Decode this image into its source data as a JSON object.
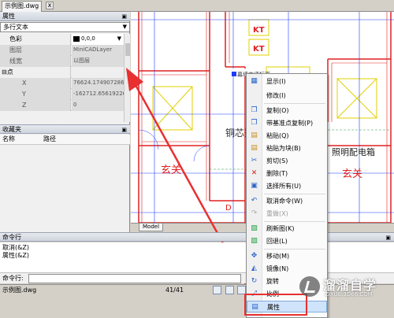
{
  "tab": {
    "title": "示例图.dwg",
    "close": "x"
  },
  "properties": {
    "title": "属性",
    "pin": "ᴘ",
    "object_type": "多行文本",
    "rows": [
      {
        "name": "色彩",
        "value": "0,0,0"
      },
      {
        "name": "图层",
        "value": "MiniCADLayer"
      },
      {
        "name": "线宽",
        "value": "以图层"
      },
      {
        "name": "点",
        "value": ""
      },
      {
        "name": "X",
        "value": "76624.174907286"
      },
      {
        "name": "Y",
        "value": "-162712.65619226"
      },
      {
        "name": "Z",
        "value": "0"
      }
    ],
    "group_toggle": "⊟"
  },
  "favorites": {
    "title": "收藏夹",
    "col_name": "名称",
    "col_path": "路径"
  },
  "drawing": {
    "labels": {
      "kt1": "KT",
      "kt2": "KT",
      "room1": "铜芯梁",
      "room2": "照明配电箱",
      "xuanguan1": "玄关",
      "xuanguan2": "玄关",
      "d_mark": "D",
      "top_text": "幕墙商墙标高"
    },
    "model_tab": "Model"
  },
  "context_menu": {
    "items": [
      {
        "label": "显示(I)",
        "icon": "▦"
      },
      {
        "label": "修改(I)",
        "icon": ""
      },
      {
        "label": "复制(O)",
        "icon": "❐"
      },
      {
        "label": "带基准点复制(P)",
        "icon": "❐"
      },
      {
        "label": "粘贴(Q)",
        "icon": "▤"
      },
      {
        "label": "粘贴为块(B)",
        "icon": "▤"
      },
      {
        "label": "剪切(S)",
        "icon": "✂"
      },
      {
        "label": "删除(T)",
        "icon": "✕"
      },
      {
        "label": "选择所有(U)",
        "icon": "▣"
      },
      {
        "label": "取消命令(W)",
        "icon": "↶"
      },
      {
        "label": "重做(X)",
        "icon": "↷"
      },
      {
        "label": "刷新图(K)",
        "icon": "▨"
      },
      {
        "label": "回退(L)",
        "icon": "▨"
      },
      {
        "label": "移动(M)",
        "icon": "✥"
      },
      {
        "label": "镜像(N)",
        "icon": "◭"
      },
      {
        "label": "旋转",
        "icon": "↻"
      },
      {
        "label": "比例",
        "icon": "⤢"
      },
      {
        "label": "属性",
        "icon": "▤"
      }
    ]
  },
  "command": {
    "title": "命令行",
    "log": [
      "取消(&Z)",
      "属性(&Z)"
    ],
    "input_label": "命令行:",
    "input_value": ""
  },
  "status": {
    "file": "示例图.dwg",
    "page": "41/41"
  },
  "watermark": {
    "title": "溜溜自学",
    "url": "ZIXUE.3D66.COM"
  },
  "colors": {
    "wall_red": "#e02020",
    "line_blue": "#1e3cff",
    "box_yellow": "#e0d000",
    "annotation_red": "#e83030"
  }
}
